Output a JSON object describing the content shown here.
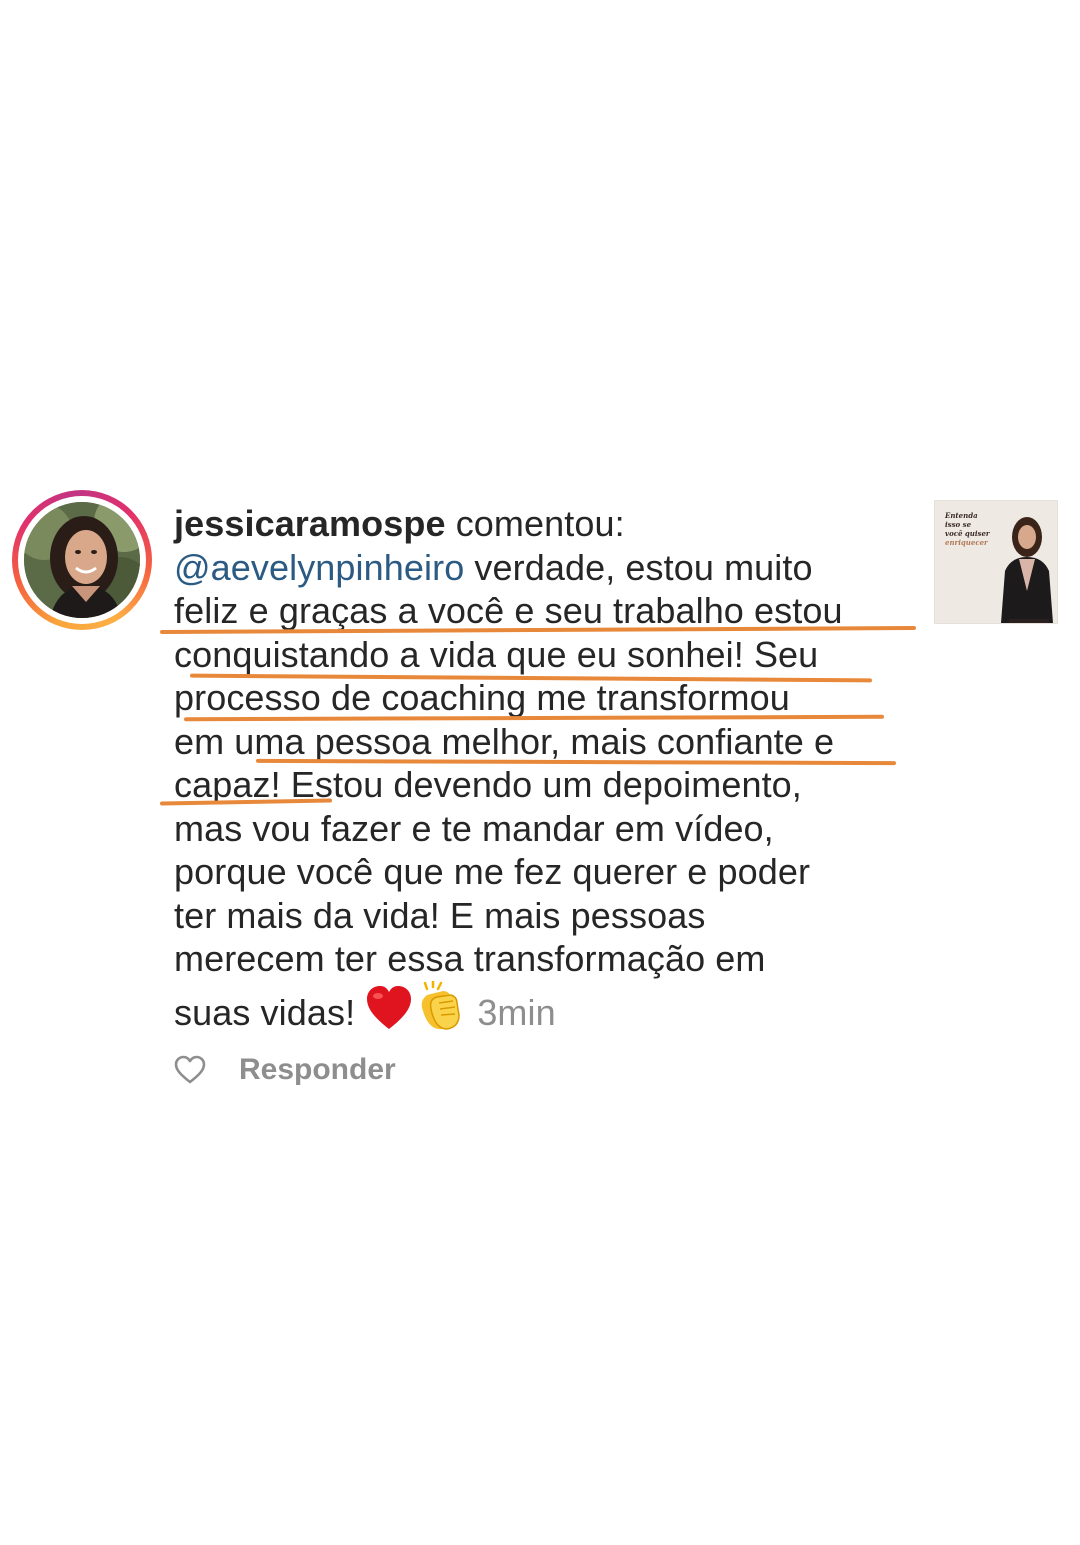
{
  "comment": {
    "username": "jessicaramospe",
    "action": "comentou:",
    "mention": "@aevelynpinheiro",
    "lines": [
      " verdade, estou muito",
      "feliz e graças a você e seu trabalho estou",
      "conquistando a vida que eu sonhei! Seu",
      "processo de coaching me transformou",
      "em uma pessoa melhor, mais confiante e",
      "capaz! Estou devendo um depoimento,",
      "mas vou fazer e te mandar em vídeo,",
      "porque você que me fez querer e poder",
      "ter mais da vida! E mais pessoas",
      "merecem ter essa transformação em",
      "suas vidas!"
    ],
    "emojis": [
      "heart-emoji",
      "clapping-hands-emoji"
    ],
    "timestamp": "3min",
    "reply_label": "Responder",
    "like_icon": "heart-outline-icon",
    "avatar_icon": "profile-photo",
    "highlight_color": "#e8883a",
    "mention_color": "#2b5a83"
  },
  "thumbnail": {
    "text_lines": [
      "Entenda",
      "isso se",
      "você quiser",
      "enriquecer"
    ]
  }
}
